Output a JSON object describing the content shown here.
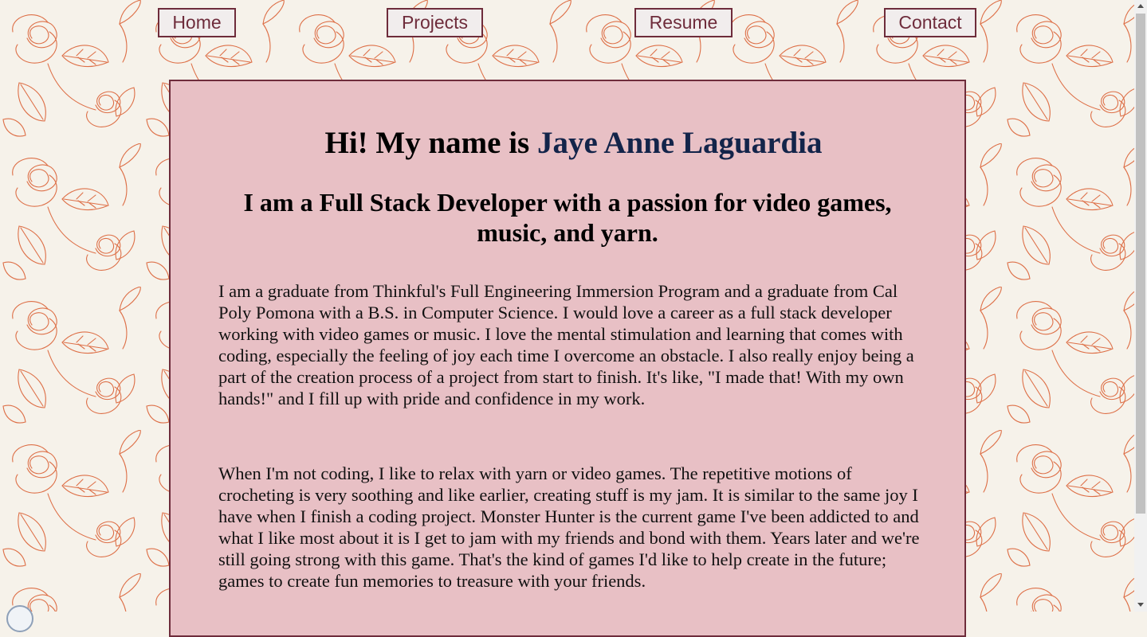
{
  "nav": {
    "home_label": "Home",
    "projects_label": "Projects",
    "resume_label": "Resume",
    "contact_label": "Contact"
  },
  "hero": {
    "greeting": "Hi! My name is ",
    "name": "Jaye Anne Laguardia"
  },
  "tagline": "I am a Full Stack Developer with a passion for video games, music, and yarn.",
  "bio": {
    "paragraph_1": "I am a graduate from Thinkful's Full Engineering Immersion Program and a graduate from Cal Poly Pomona with a B.S. in Computer Science. I would love a career as a full stack developer working with video games or music. I love the mental stimulation and learning that comes with coding, especially the feeling of joy each time I overcome an obstacle. I also really enjoy being a part of the creation process of a project from start to finish. It's like, \"I made that! With my own hands!\" and I fill up with pride and confidence in my work.",
    "paragraph_2": "When I'm not coding, I like to relax with yarn or video games. The repetitive motions of crocheting is very soothing and like earlier, creating stuff is my jam. It is similar to the same joy I have when I finish a coding project. Monster Hunter is the current game I've been addicted to and what I like most about it is I get to jam with my friends and bond with them. Years later and we're still going strong with this game. That's the kind of games I'd like to help create in the future; games to create fun memories to treasure with your friends."
  },
  "colors": {
    "background": "#f6f2ea",
    "floral_line": "#d9582a",
    "card_fill": "#e8c0c5",
    "accent_border": "#6e2c3b",
    "name_color": "#13244a"
  },
  "icons": {
    "background_pattern": "rose-floral-pattern-icon"
  }
}
